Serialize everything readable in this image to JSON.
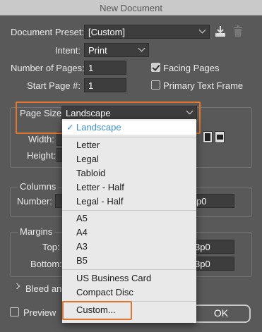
{
  "window": {
    "title": "New Document"
  },
  "preset": {
    "label": "Document Preset:",
    "value": "[Custom]"
  },
  "intent": {
    "label": "Intent:",
    "value": "Print"
  },
  "pages": {
    "label": "Number of Pages:",
    "value": "1"
  },
  "start_page": {
    "label": "Start Page #:",
    "value": "1"
  },
  "facing_pages": {
    "label": "Facing Pages",
    "checked": true
  },
  "primary_text_frame": {
    "label": "Primary Text Frame",
    "checked": false
  },
  "page_size": {
    "label": "Page Size:",
    "value": "Landscape"
  },
  "width": {
    "label": "Width:"
  },
  "height": {
    "label": "Height:"
  },
  "columns": {
    "section": "Columns",
    "number_label": "Number:",
    "gutter_value": "p0"
  },
  "margins": {
    "section": "Margins",
    "top_label": "Top:",
    "bottom_label": "Bottom:",
    "top_value": "3p0",
    "bottom_value": "3p0"
  },
  "bleed": {
    "label": "Bleed and"
  },
  "preview": {
    "label": "Preview",
    "checked": false
  },
  "ok_button": {
    "label": "OK"
  },
  "menu": {
    "selected": "Landscape",
    "items": [
      "Letter",
      "Legal",
      "Tabloid",
      "Letter - Half",
      "Legal - Half",
      "A5",
      "A4",
      "A3",
      "B5",
      "US Business Card",
      "Compact Disc",
      "Custom..."
    ]
  }
}
